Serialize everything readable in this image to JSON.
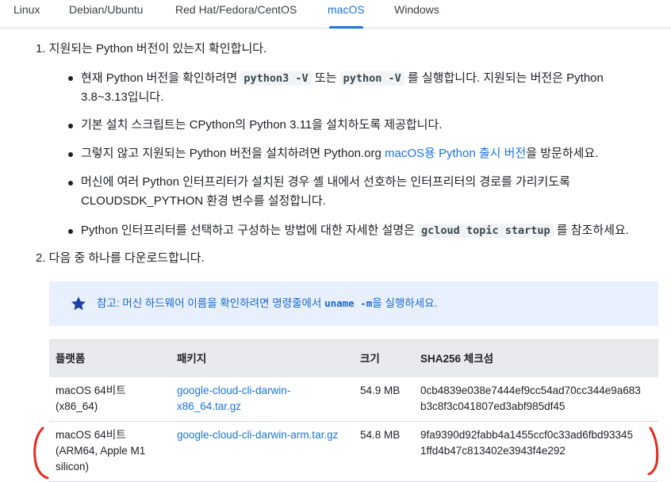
{
  "tabs": [
    {
      "label": "Linux",
      "active": false
    },
    {
      "label": "Debian/Ubuntu",
      "active": false
    },
    {
      "label": "Red Hat/Fedora/CentOS",
      "active": false
    },
    {
      "label": "macOS",
      "active": true
    },
    {
      "label": "Windows",
      "active": false
    }
  ],
  "steps": {
    "step1": "1. 지원되는 Python 버전이 있는지 확인합니다.",
    "step2": "2. 다음 중 하나를 다운로드합니다."
  },
  "bullets": {
    "b1_pre": "현재 Python 버전을 확인하려면 ",
    "b1_code1": "python3 -V",
    "b1_mid": " 또는 ",
    "b1_code2": "python -V",
    "b1_post": " 를 실행합니다. 지원되는 버전은 Python 3.8~3.13입니다.",
    "b2": "기본 설치 스크립트는 CPython의 Python 3.11을 설치하도록 제공합니다.",
    "b3_pre": "그렇지 않고 지원되는 Python 버전을 설치하려면 Python.org ",
    "b3_link": "macOS용 Python 출시 버전",
    "b3_post": "을 방문하세요.",
    "b4": "머신에 여러 Python 인터프리터가 설치된 경우 셸 내에서 선호하는 인터프리터의 경로를 가리키도록 CLOUDSDK_PYTHON 환경 변수를 설정합니다.",
    "b5_pre": "Python 인터프리터를 선택하고 구성하는 방법에 대한 자세한 설명은 ",
    "b5_code": "gcloud topic startup",
    "b5_post": " 를 참조하세요."
  },
  "note": {
    "pre": "참고: 머신 하드웨어 이름을 확인하려면 명령줄에서 ",
    "code": "uname -m",
    "post": "을 실행하세요.",
    "icon": "star-icon"
  },
  "table": {
    "headers": [
      "플랫폼",
      "패키지",
      "크기",
      "SHA256 체크섬"
    ],
    "rows": [
      {
        "platform_1": "macOS 64비트",
        "platform_2": "(x86_64)",
        "package_1": "google-cloud-cli-darwin-",
        "package_2": "x86_64.tar.gz",
        "size": "54.9 MB",
        "sha_1": "0cb4839e038e7444ef9cc54ad70cc344e9a683",
        "sha_2": "b3c8f3c041807ed3abf985df45"
      },
      {
        "platform_1": "macOS 64비트",
        "platform_2": "(ARM64, Apple M1",
        "platform_3": "silicon)",
        "package_1": "google-cloud-cli-darwin-arm.tar.gz",
        "size": "54.8 MB",
        "sha_1": "9fa9390d92fabb4a1455ccf0c33ad6fbd93345",
        "sha_2": "1ffd4b47c813402e3943f4e292"
      }
    ]
  },
  "colors": {
    "accent": "#1a73e8",
    "note_bg": "#e8f0fe",
    "annotation": "#e8281e"
  }
}
